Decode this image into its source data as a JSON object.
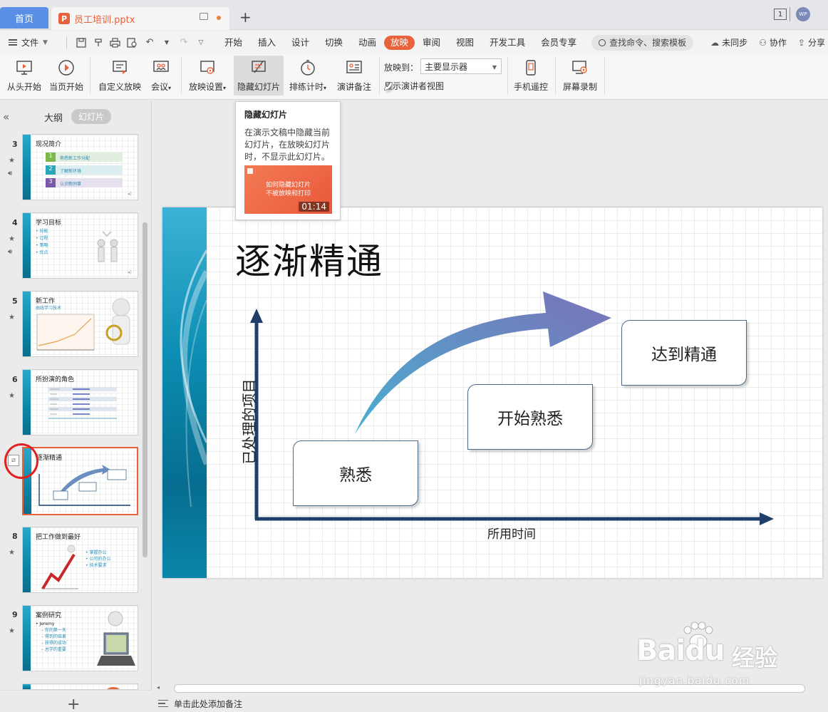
{
  "tabs": {
    "home": "首页",
    "doc": "员工培训.pptx",
    "new_tab": "+",
    "win_num": "1",
    "avatar": "WP"
  },
  "menu": {
    "file": "文件",
    "tabs": [
      "开始",
      "插入",
      "设计",
      "切换",
      "动画",
      "放映",
      "审阅",
      "视图",
      "开发工具",
      "会员专享"
    ],
    "active_tab": "放映",
    "search": "查找命令、搜索模板",
    "sync": "未同步",
    "collab": "协作",
    "share": "分享"
  },
  "ribbon": {
    "from_start": "从头开始",
    "from_current": "当页开始",
    "custom_show": "自定义放映",
    "meeting": "会议",
    "setup_show": "放映设置",
    "hide_slide": "隐藏幻灯片",
    "rehearse": "排练计时",
    "narration": "演讲备注",
    "cast_to_label": "放映到：",
    "cast_to_value": "主要显示器",
    "presenter_view": "显示演讲者视图",
    "phone_remote": "手机遥控",
    "screen_record": "屏幕录制"
  },
  "tooltip": {
    "title": "隐藏幻灯片",
    "body": "在演示文稿中隐藏当前幻灯片，在放映幻灯片时，不显示此幻灯片。",
    "video_text": "如何隐藏幻灯片\n不被放映和打印",
    "video_time": "01:14"
  },
  "left_panel": {
    "outline_tab": "大纲",
    "slides_tab": "幻灯片",
    "add": "+",
    "slides": [
      {
        "no": "3",
        "title": "现况简介",
        "items": [
          "熟悉新工作分配",
          "了解新环境",
          "认识新同事"
        ]
      },
      {
        "no": "4",
        "title": "学习目标",
        "items": [
          "技能",
          "过程",
          "策略",
          "优点"
        ]
      },
      {
        "no": "5",
        "title": "新工作",
        "subtitle": "由线学习技术"
      },
      {
        "no": "6",
        "title": "所扮演的角色"
      },
      {
        "no": "7",
        "title": "逐渐精通"
      },
      {
        "no": "8",
        "title": "把工作做到最好",
        "items": [
          "掌握办公",
          "公司的办公",
          "技术要求"
        ]
      },
      {
        "no": "9",
        "title": "案例研究",
        "items": [
          "Jeremy",
          "你的第一天",
          "得到的结果",
          "获得的成功",
          "总学的重要"
        ]
      }
    ]
  },
  "slide": {
    "title": "逐渐精通",
    "box1": "熟悉",
    "box2": "开始熟悉",
    "box3": "达到精通",
    "y_axis": "已处理的项目",
    "x_axis": "所用时间"
  },
  "notes": {
    "placeholder": "单击此处添加备注"
  },
  "watermark": {
    "logo": "Baidu",
    "cn": "经验",
    "url": "jingyan.baidu.com"
  },
  "colors": {
    "accent": "#e8623b",
    "home_tab": "#5a8fe6",
    "teal_bar": "#0c8db3",
    "axis": "#1f3f6b"
  }
}
